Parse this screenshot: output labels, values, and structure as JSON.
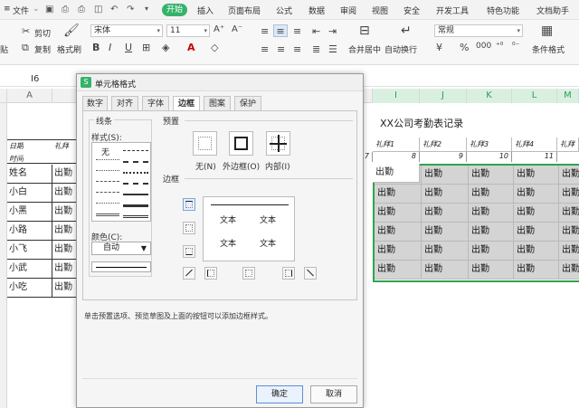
{
  "menubar": {
    "file": "文件",
    "start": "开始",
    "tabs": [
      "插入",
      "页面布局",
      "公式",
      "数据",
      "审阅",
      "视图",
      "安全",
      "开发工具",
      "特色功能",
      "文档助手"
    ]
  },
  "toolbar": {
    "cut": "剪切",
    "copy": "复制",
    "format_painter": "格式刷",
    "paste": "贴",
    "font_name": "宋体",
    "font_size": "11",
    "merge_center": "合并居中",
    "wrap_text": "自动换行",
    "number_format": "常规",
    "cond_format": "条件格式"
  },
  "formula_bar": {
    "name_box": "I6"
  },
  "columns": {
    "left": [
      "A"
    ],
    "right": [
      "I",
      "J",
      "K",
      "L",
      "M"
    ]
  },
  "sheet": {
    "title": "XX公司考勤表记录",
    "row_header_labels": [
      "日期",
      "时间"
    ],
    "col_b_header": "礼拜",
    "names": [
      "姓名",
      "小白",
      "小黑",
      "小路",
      "小飞",
      "小武",
      "小吃"
    ],
    "col_b_values": [
      "出勤",
      "出勤",
      "出勤",
      "出勤",
      "出勤",
      "出勤",
      "出勤"
    ],
    "day_headers": [
      "礼拜1",
      "礼拜2",
      "礼拜3",
      "礼拜4",
      "礼拜"
    ],
    "day_numbers": [
      "7",
      "8",
      "9",
      "10",
      "11"
    ],
    "grid_value": "出勤"
  },
  "dialog": {
    "title": "单元格格式",
    "tabs": [
      "数字",
      "对齐",
      "字体",
      "边框",
      "图案",
      "保护"
    ],
    "active_tab": "边框",
    "line_group": "线条",
    "style_label": "样式(S):",
    "none_style": "无",
    "color_label": "颜色(C):",
    "color_value": "自动",
    "preset_group": "预置",
    "presets": [
      "无(N)",
      "外边框(O)",
      "内部(I)"
    ],
    "border_group": "边框",
    "preview_text": [
      "文本",
      "文本",
      "文本",
      "文本"
    ],
    "hint": "单击预置选项、预览草图及上面的按钮可以添加边框样式。",
    "ok": "确定",
    "cancel": "取消"
  },
  "colors": {
    "accent": "#34b36a",
    "selection_border": "#2ea44f",
    "selected_fill": "#d4d4d4"
  }
}
